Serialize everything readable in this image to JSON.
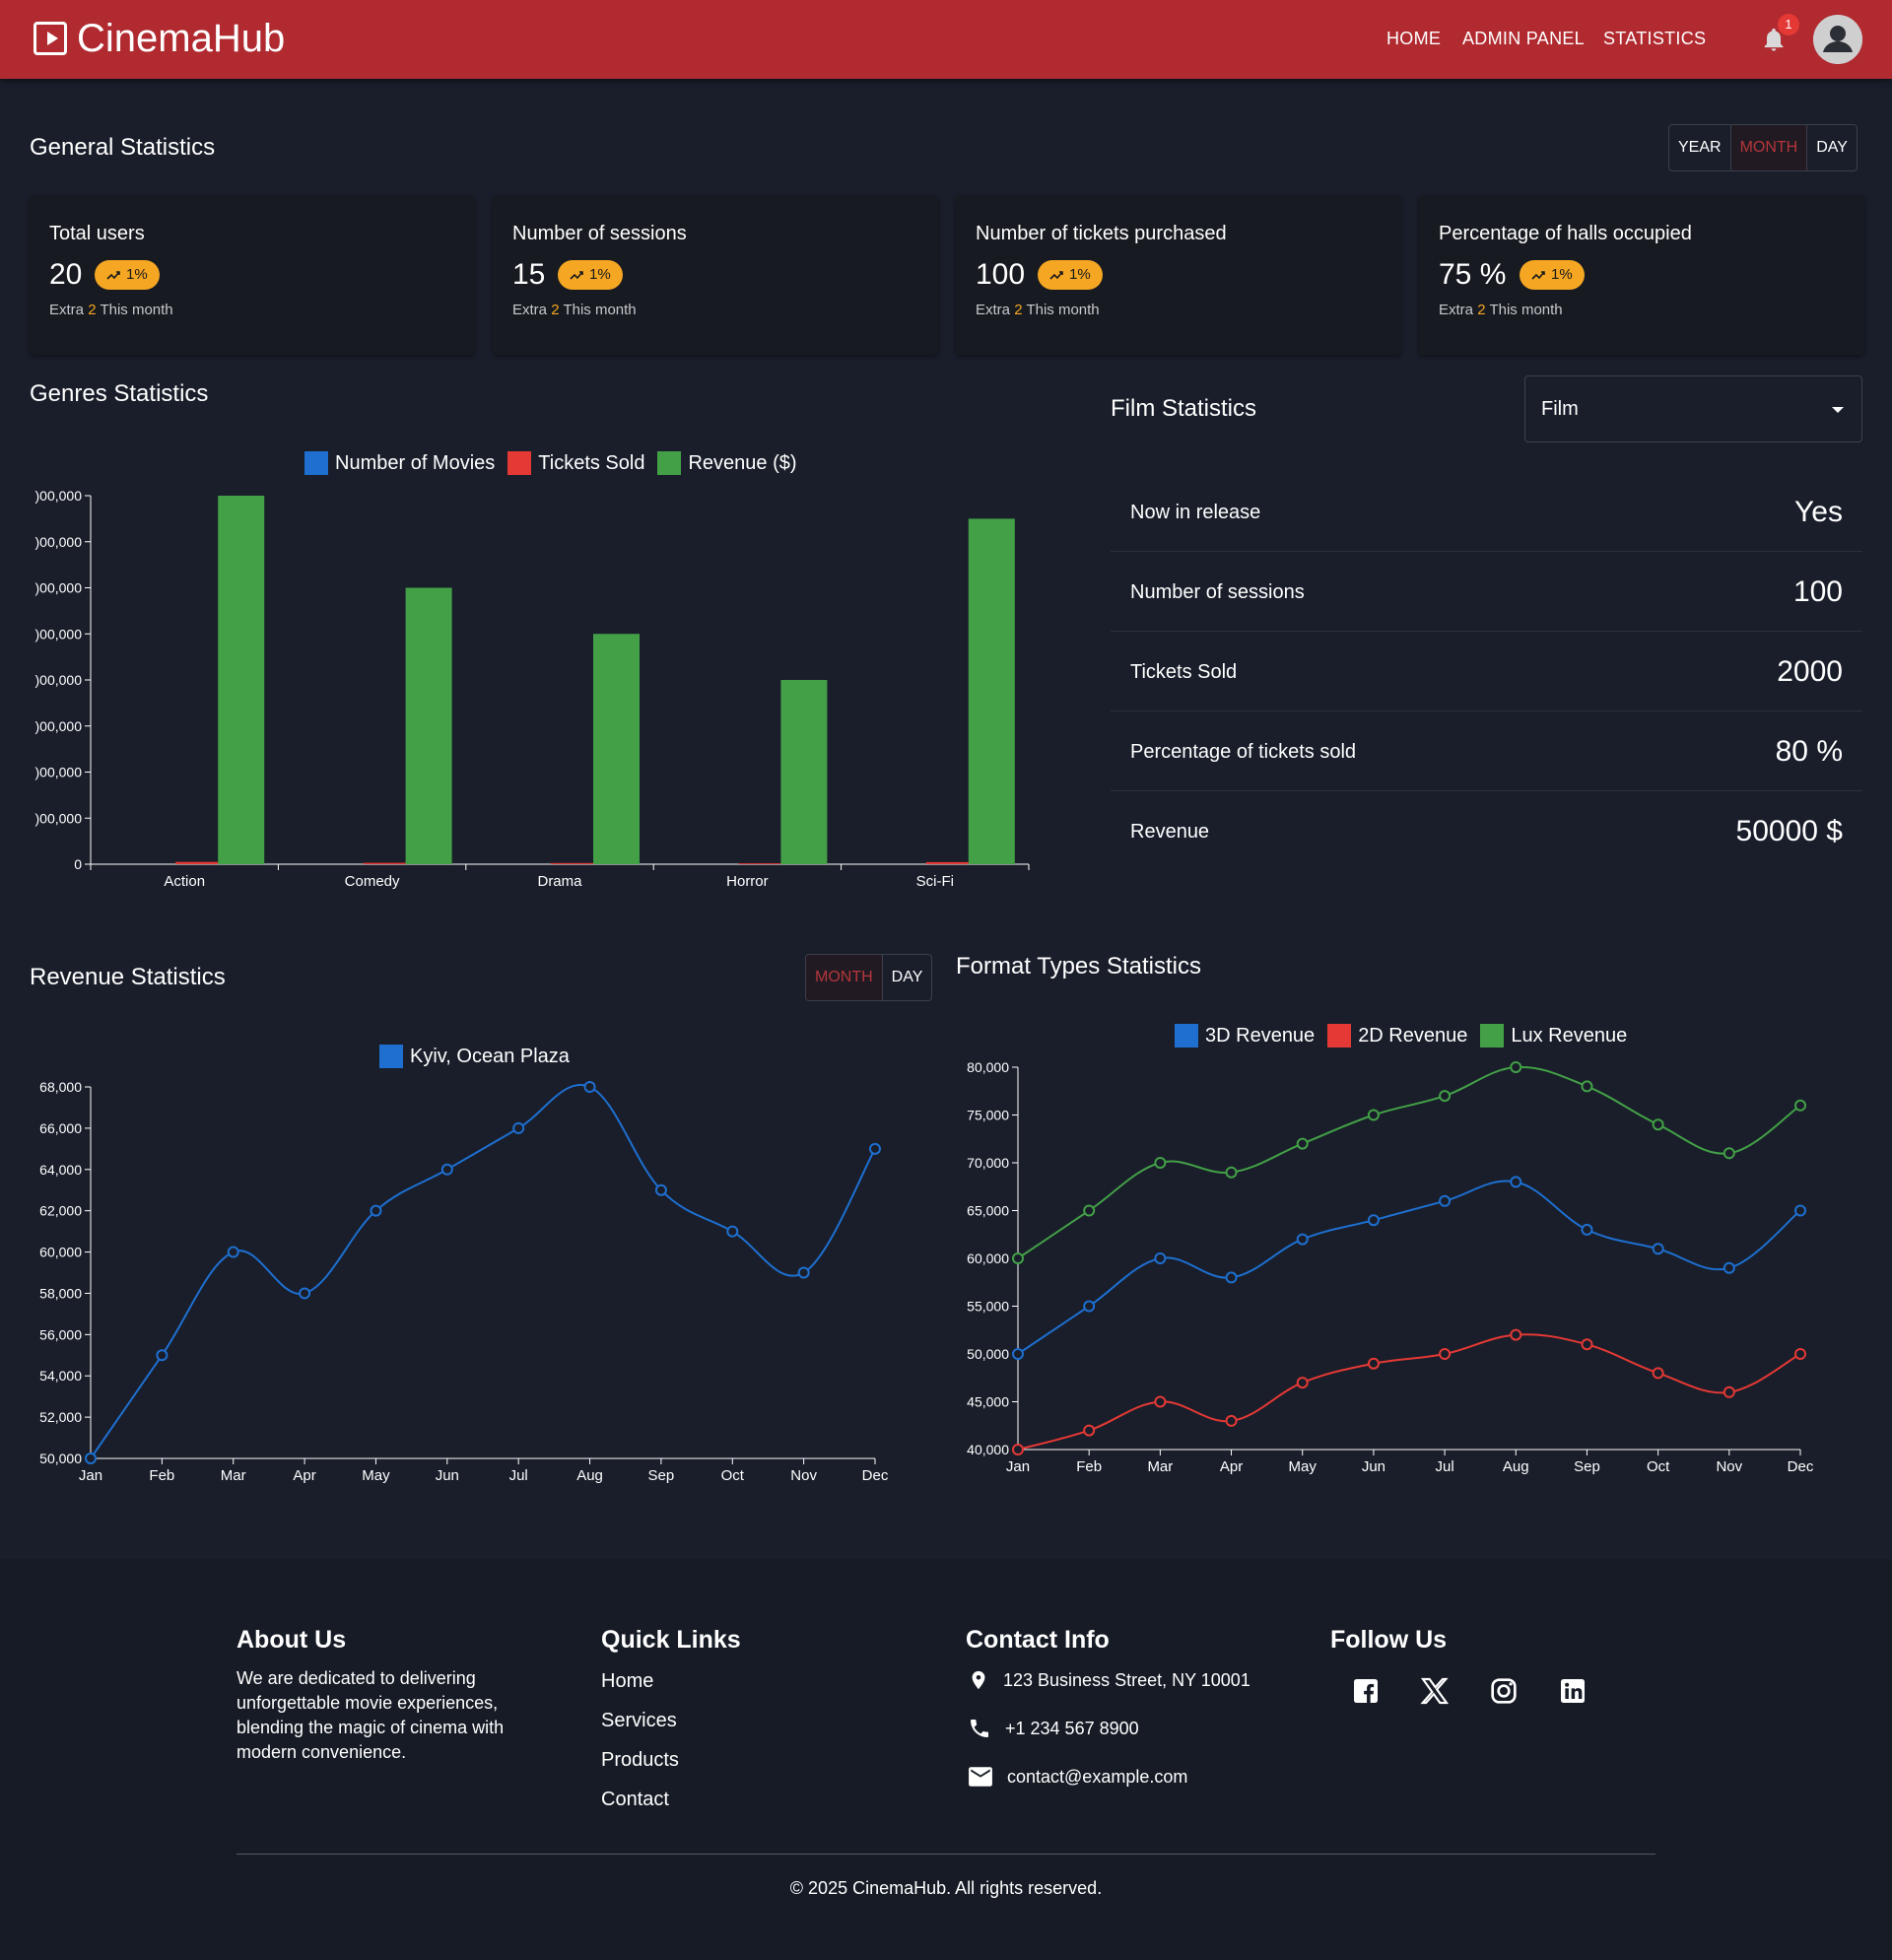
{
  "brand": {
    "name": "CinemaHub"
  },
  "nav": {
    "home": "HOME",
    "admin": "ADMIN PANEL",
    "statistics": "STATISTICS",
    "notification_count": "1"
  },
  "general": {
    "title": "General Statistics",
    "periods": [
      "YEAR",
      "MONTH",
      "DAY"
    ],
    "active_period": "MONTH",
    "cards": [
      {
        "title": "Total users",
        "value": "20",
        "chip": "1%",
        "sub_prefix": "Extra",
        "sub_count": "2",
        "sub_suffix": "This month"
      },
      {
        "title": "Number of sessions",
        "value": "15",
        "chip": "1%",
        "sub_prefix": "Extra",
        "sub_count": "2",
        "sub_suffix": "This month"
      },
      {
        "title": "Number of tickets purchased",
        "value": "100",
        "chip": "1%",
        "sub_prefix": "Extra",
        "sub_count": "2",
        "sub_suffix": "This month"
      },
      {
        "title": "Percentage of halls occupied",
        "value": "75 %",
        "chip": "1%",
        "sub_prefix": "Extra",
        "sub_count": "2",
        "sub_suffix": "This month"
      }
    ]
  },
  "genres": {
    "title": "Genres Statistics"
  },
  "film": {
    "title": "Film Statistics",
    "select_value": "Film",
    "rows": [
      {
        "label": "Now in release",
        "value": "Yes"
      },
      {
        "label": "Number of sessions",
        "value": "100"
      },
      {
        "label": "Tickets Sold",
        "value": "2000"
      },
      {
        "label": "Percentage of tickets sold",
        "value": "80 %"
      },
      {
        "label": "Revenue",
        "value": "50000 $"
      }
    ]
  },
  "revenue": {
    "title": "Revenue Statistics",
    "periods": [
      "MONTH",
      "DAY"
    ],
    "active_period": "MONTH"
  },
  "formats": {
    "title": "Format Types Statistics"
  },
  "chart_data": [
    {
      "id": "genres",
      "type": "bar",
      "categories": [
        "Action",
        "Comedy",
        "Drama",
        "Horror",
        "Sci-Fi"
      ],
      "series": [
        {
          "name": "Number of Movies",
          "color": "#1e6fd0",
          "values": [
            12,
            8,
            10,
            6,
            9
          ]
        },
        {
          "name": "Tickets Sold",
          "color": "#e53935",
          "values": [
            5000,
            3000,
            2500,
            2000,
            4500
          ]
        },
        {
          "name": "Revenue ($)",
          "color": "#43a047",
          "values": [
            800000,
            600000,
            500000,
            400000,
            750000
          ]
        }
      ],
      "ylim": [
        0,
        800000
      ],
      "yticks": [
        0,
        100000,
        200000,
        300000,
        400000,
        500000,
        600000,
        700000,
        800000
      ],
      "ytick_labels": [
        "0",
        ")00,000",
        ")00,000",
        ")00,000",
        ")00,000",
        ")00,000",
        ")00,000",
        ")00,000",
        ")00,000"
      ],
      "legend": "top-center"
    },
    {
      "id": "revenue",
      "type": "line",
      "x": [
        "Jan",
        "Feb",
        "Mar",
        "Apr",
        "May",
        "Jun",
        "Jul",
        "Aug",
        "Sep",
        "Oct",
        "Nov",
        "Dec"
      ],
      "series": [
        {
          "name": "Kyiv, Ocean Plaza",
          "color": "#1e6fd0",
          "values": [
            50000,
            55000,
            60000,
            58000,
            62000,
            64000,
            66000,
            68000,
            63000,
            61000,
            59000,
            65000
          ]
        }
      ],
      "ylim": [
        50000,
        68000
      ],
      "yticks": [
        50000,
        52000,
        54000,
        56000,
        58000,
        60000,
        62000,
        64000,
        66000,
        68000
      ],
      "ytick_labels": [
        "50,000",
        "52,000",
        "54,000",
        "56,000",
        "58,000",
        "60,000",
        "62,000",
        "64,000",
        "66,000",
        "68,000"
      ],
      "legend": "top-center"
    },
    {
      "id": "formats",
      "type": "line",
      "x": [
        "Jan",
        "Feb",
        "Mar",
        "Apr",
        "May",
        "Jun",
        "Jul",
        "Aug",
        "Sep",
        "Oct",
        "Nov",
        "Dec"
      ],
      "series": [
        {
          "name": "3D Revenue",
          "color": "#1e6fd0",
          "values": [
            50000,
            55000,
            60000,
            58000,
            62000,
            64000,
            66000,
            68000,
            63000,
            61000,
            59000,
            65000
          ]
        },
        {
          "name": "2D Revenue",
          "color": "#e53935",
          "values": [
            40000,
            42000,
            45000,
            43000,
            47000,
            49000,
            50000,
            52000,
            51000,
            48000,
            46000,
            50000
          ]
        },
        {
          "name": "Lux Revenue",
          "color": "#43a047",
          "values": [
            60000,
            65000,
            70000,
            69000,
            72000,
            75000,
            77000,
            80000,
            78000,
            74000,
            71000,
            76000
          ]
        }
      ],
      "ylim": [
        40000,
        80000
      ],
      "yticks": [
        40000,
        45000,
        50000,
        55000,
        60000,
        65000,
        70000,
        75000,
        80000
      ],
      "ytick_labels": [
        "40,000",
        "45,000",
        "50,000",
        "55,000",
        "60,000",
        "65,000",
        "70,000",
        "75,000",
        "80,000"
      ],
      "legend": "top-center"
    }
  ],
  "footer": {
    "about_title": "About Us",
    "about_text": "We are dedicated to delivering unforgettable movie experiences, blending the magic of cinema with modern convenience.",
    "links_title": "Quick Links",
    "links": [
      "Home",
      "Services",
      "Products",
      "Contact"
    ],
    "contact_title": "Contact Info",
    "address": "123 Business Street, NY 10001",
    "phone": "+1 234 567 8900",
    "email": "contact@example.com",
    "follow_title": "Follow Us",
    "social_icons": [
      "facebook-icon",
      "x-icon",
      "instagram-icon",
      "linkedin-icon"
    ],
    "copyright": "© 2025 CinemaHub. All rights reserved."
  },
  "colors": {
    "header": "#b02a30",
    "background": "#191e2a",
    "card": "#171a20",
    "accent": "#f5a623"
  }
}
